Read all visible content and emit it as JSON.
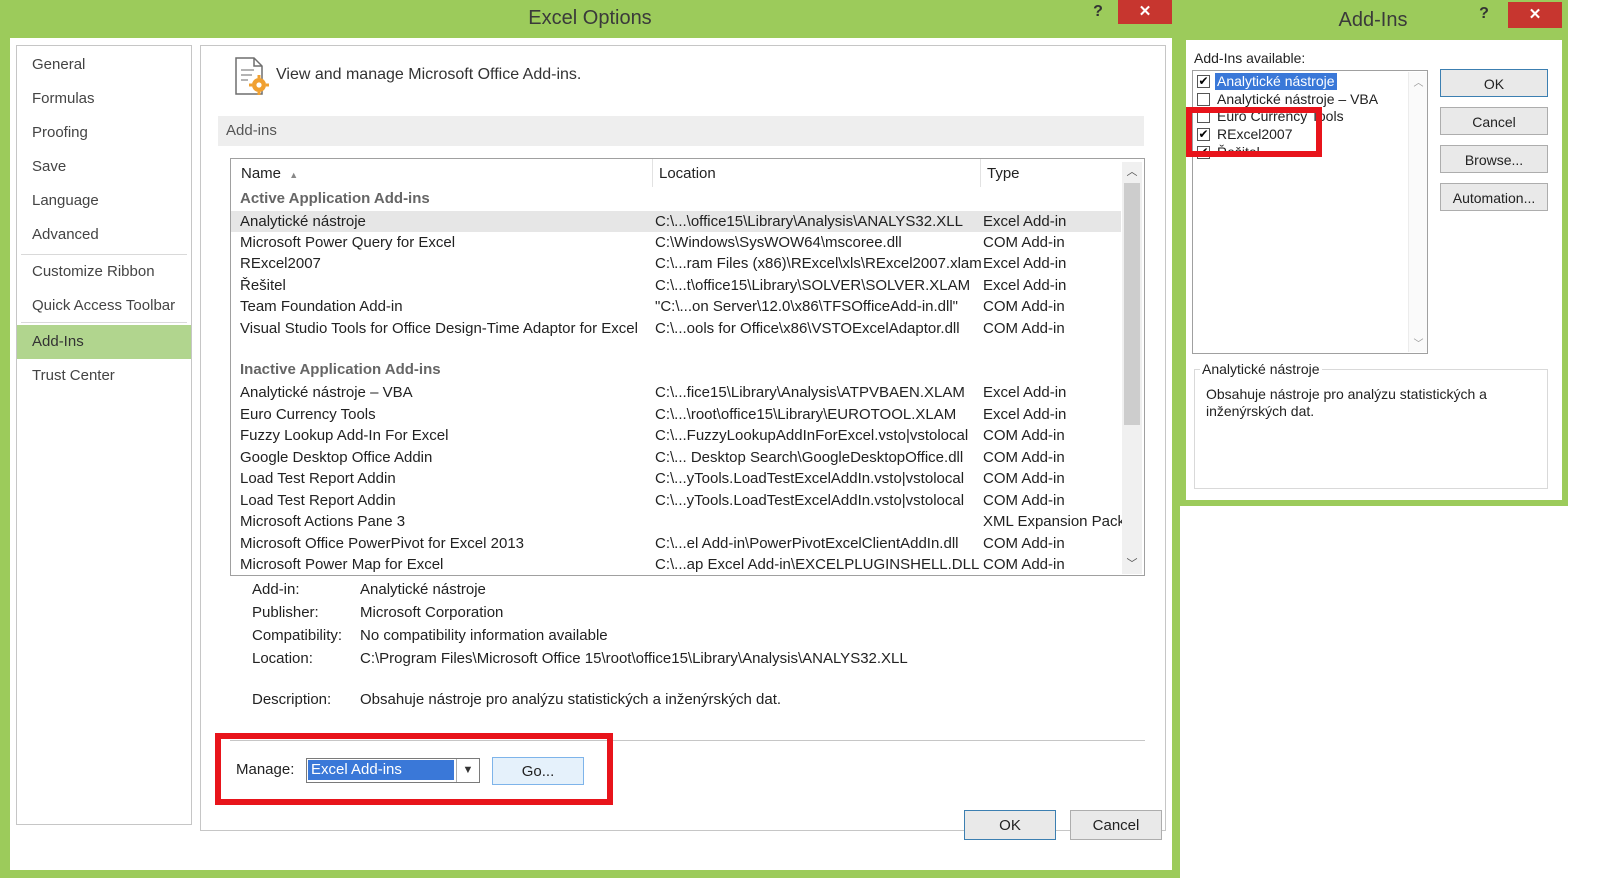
{
  "options_window": {
    "title": "Excel Options",
    "help": "?",
    "close": "✕",
    "nav": [
      {
        "label": "General"
      },
      {
        "label": "Formulas"
      },
      {
        "label": "Proofing"
      },
      {
        "label": "Save"
      },
      {
        "label": "Language"
      },
      {
        "label": "Advanced"
      },
      {
        "label": "Customize Ribbon"
      },
      {
        "label": "Quick Access Toolbar"
      },
      {
        "label": "Add-Ins",
        "selected": true
      },
      {
        "label": "Trust Center"
      }
    ],
    "header_text": "View and manage Microsoft Office Add-ins.",
    "section_title": "Add-ins",
    "columns": {
      "name": "Name",
      "location": "Location",
      "type": "Type"
    },
    "active_group": "Active Application Add-ins",
    "active_rows": [
      {
        "name": "Analytické nástroje",
        "location": "C:\\...\\office15\\Library\\Analysis\\ANALYS32.XLL",
        "type": "Excel Add-in"
      },
      {
        "name": "Microsoft Power Query for Excel",
        "location": "C:\\Windows\\SysWOW64\\mscoree.dll",
        "type": "COM Add-in"
      },
      {
        "name": "RExcel2007",
        "location": "C:\\...ram Files (x86)\\RExcel\\xls\\RExcel2007.xlam",
        "type": "Excel Add-in"
      },
      {
        "name": "Řešitel",
        "location": "C:\\...t\\office15\\Library\\SOLVER\\SOLVER.XLAM",
        "type": "Excel Add-in"
      },
      {
        "name": "Team Foundation Add-in",
        "location": "\"C:\\...on Server\\12.0\\x86\\TFSOfficeAdd-in.dll\"",
        "type": "COM Add-in"
      },
      {
        "name": "Visual Studio Tools for Office Design-Time Adaptor for Excel",
        "location": "C:\\...ools for Office\\x86\\VSTOExcelAdaptor.dll",
        "type": "COM Add-in"
      }
    ],
    "inactive_group": "Inactive Application Add-ins",
    "inactive_rows": [
      {
        "name": "Analytické nástroje – VBA",
        "location": "C:\\...fice15\\Library\\Analysis\\ATPVBAEN.XLAM",
        "type": "Excel Add-in"
      },
      {
        "name": "Euro Currency Tools",
        "location": "C:\\...\\root\\office15\\Library\\EUROTOOL.XLAM",
        "type": "Excel Add-in"
      },
      {
        "name": "Fuzzy Lookup Add-In For Excel",
        "location": "C:\\...FuzzyLookupAddInForExcel.vsto|vstolocal",
        "type": "COM Add-in"
      },
      {
        "name": "Google Desktop Office Addin",
        "location": "C:\\... Desktop Search\\GoogleDesktopOffice.dll",
        "type": "COM Add-in"
      },
      {
        "name": "Load Test Report Addin",
        "location": "C:\\...yTools.LoadTestExcelAddIn.vsto|vstolocal",
        "type": "COM Add-in"
      },
      {
        "name": "Load Test Report Addin",
        "location": "C:\\...yTools.LoadTestExcelAddIn.vsto|vstolocal",
        "type": "COM Add-in"
      },
      {
        "name": "Microsoft Actions Pane 3",
        "location": "",
        "type": "XML Expansion Pack"
      },
      {
        "name": "Microsoft Office PowerPivot for Excel 2013",
        "location": "C:\\...el Add-in\\PowerPivotExcelClientAddIn.dll",
        "type": "COM Add-in"
      },
      {
        "name": "Microsoft Power Map for Excel",
        "location": "C:\\...ap Excel Add-in\\EXCELPLUGINSHELL.DLL",
        "type": "COM Add-in"
      }
    ],
    "details": {
      "addin_label": "Add-in:",
      "addin": "Analytické nástroje",
      "publisher_label": "Publisher:",
      "publisher": "Microsoft Corporation",
      "compat_label": "Compatibility:",
      "compat": "No compatibility information available",
      "location_label": "Location:",
      "location": "C:\\Program Files\\Microsoft Office 15\\root\\office15\\Library\\Analysis\\ANALYS32.XLL",
      "description_label": "Description:",
      "description": "Obsahuje nástroje pro analýzu statistických a inženýrských dat."
    },
    "manage_label": "Manage:",
    "manage_value": "Excel Add-ins",
    "go_label": "Go...",
    "ok_label": "OK",
    "cancel_label": "Cancel"
  },
  "addins_dialog": {
    "title": "Add-Ins",
    "help": "?",
    "close": "✕",
    "available_label": "Add-Ins available:",
    "items": [
      {
        "label": "Analytické nástroje",
        "checked": true,
        "selected": true
      },
      {
        "label": "Analytické nástroje – VBA",
        "checked": false
      },
      {
        "label": "Euro Currency Tools",
        "checked": false
      },
      {
        "label": "RExcel2007",
        "checked": true
      },
      {
        "label": "Řešitel",
        "checked": true
      }
    ],
    "buttons": {
      "ok": "OK",
      "cancel": "Cancel",
      "browse": "Browse...",
      "automation": "Automation..."
    },
    "desc_title": "Analytické nástroje",
    "desc_text": "Obsahuje nástroje pro analýzu statistických a inženýrských dat."
  },
  "colors": {
    "title_bar": "#9ccb5b",
    "nav_selected": "#b1d58e",
    "close_button": "#c7362f",
    "highlight_box": "#e8141b",
    "selection": "#3a78d8"
  }
}
